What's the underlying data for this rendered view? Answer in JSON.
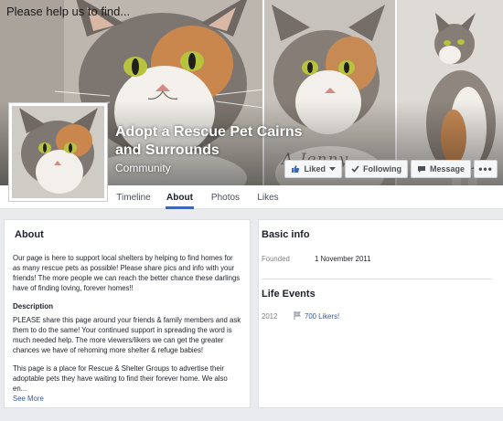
{
  "cover": {
    "caption": "Please help us to find...",
    "signature": "A Jenny",
    "panels": [
      "cat-photo-closeup",
      "cat-photo-looking-right",
      "cat-photo-sitting"
    ]
  },
  "page": {
    "name": "Adopt a Rescue Pet Cairns and Surrounds",
    "category": "Community"
  },
  "actions": {
    "liked_label": "Liked",
    "following_label": "Following",
    "message_label": "Message",
    "more_label": "•••"
  },
  "tabs": [
    {
      "label": "Timeline",
      "active": false
    },
    {
      "label": "About",
      "active": true
    },
    {
      "label": "Photos",
      "active": false
    },
    {
      "label": "Likes",
      "active": false
    }
  ],
  "about": {
    "title": "About",
    "summary": "Our page is here to support local shelters by helping to find homes for as many rescue pets as possible! Please share pics and info with your friends! The more people we can reach the better chance these darlings have of finding loving, forever homes!!",
    "description_title": "Description",
    "description_1": "PLEASE share this page around your friends & family members and ask them to do the same! Your continued support in spreading the word is much needed help. The more viewers/likers we can get the greater chances we have of rehoming more shelter & refuge babies!",
    "description_2": "This page is a place for Rescue & Shelter Groups to advertise their adoptable pets they have waiting to find their forever home. We also en...",
    "see_more": "See More"
  },
  "basic_info": {
    "title": "Basic info",
    "founded_label": "Founded",
    "founded_value": "1 November 2011"
  },
  "life_events": {
    "title": "Life Events",
    "items": [
      {
        "year": "2012",
        "label": "700 Likers!"
      }
    ]
  },
  "colors": {
    "accent": "#4267b2",
    "link": "#385898",
    "background": "#e9ebee"
  },
  "icons": [
    "like-thumb-icon",
    "chevron-down-icon",
    "checkmark-icon",
    "message-icon",
    "flag-icon"
  ]
}
